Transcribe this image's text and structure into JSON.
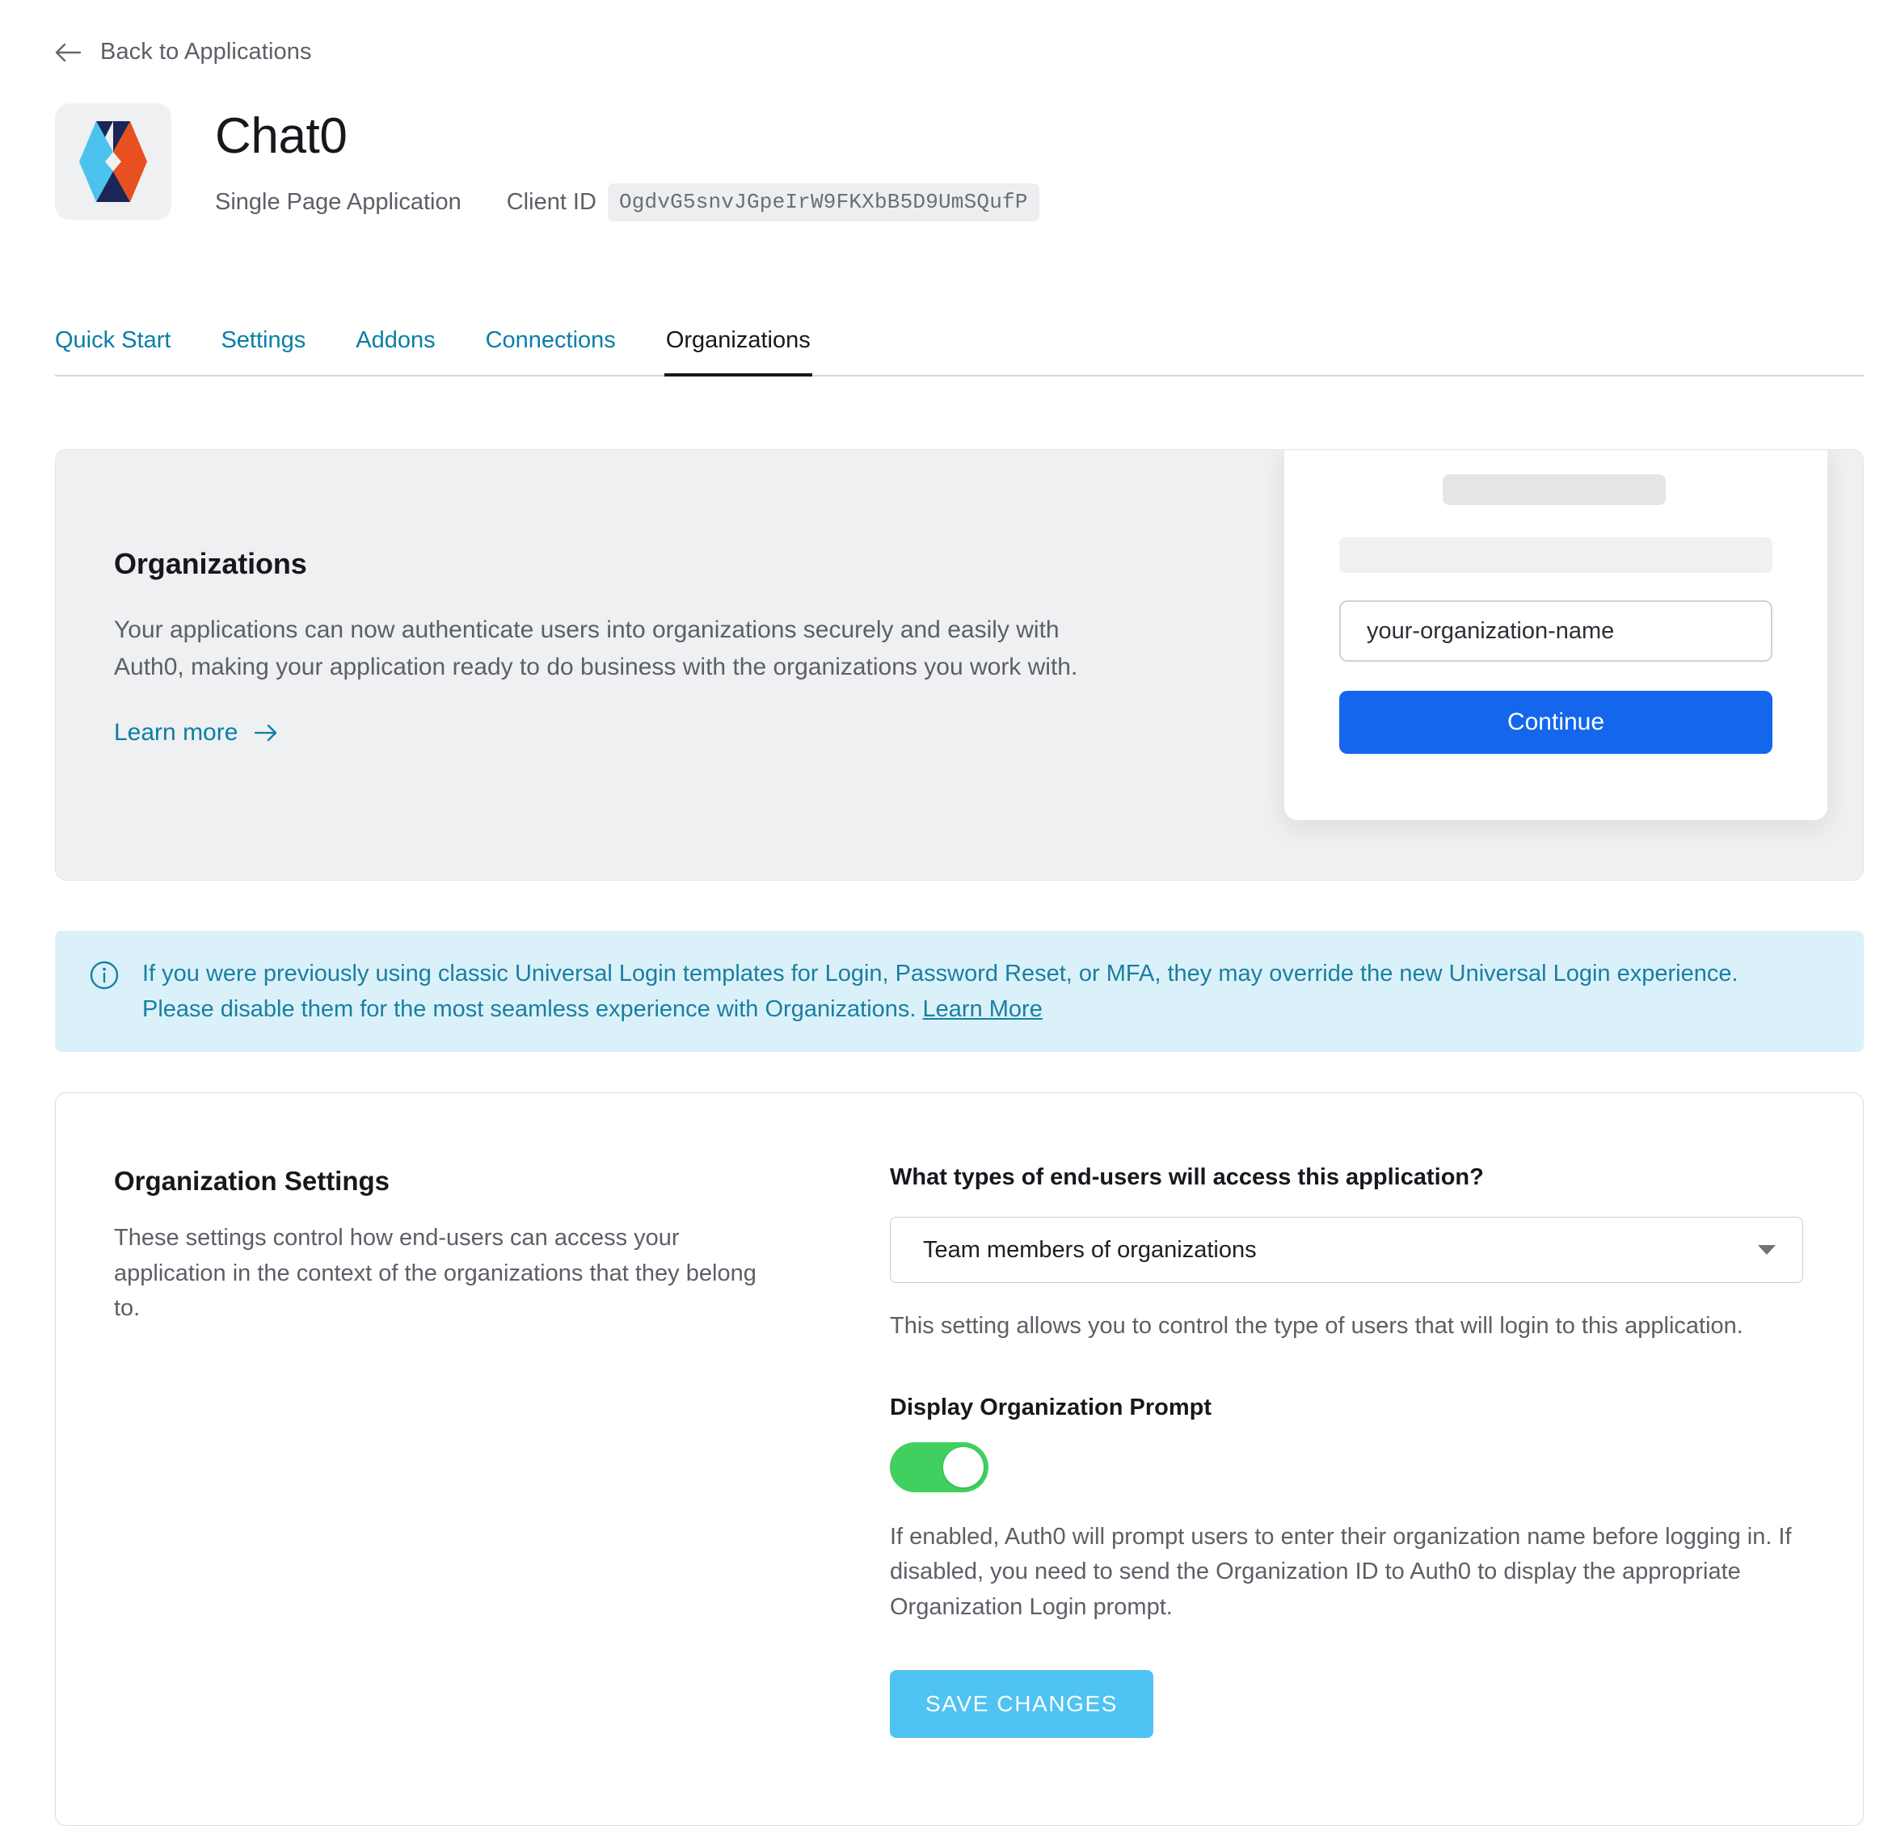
{
  "back": {
    "label": "Back to Applications",
    "icon": "arrow-left-icon"
  },
  "app": {
    "name": "Chat0",
    "type": "Single Page Application",
    "client_id_label": "Client ID",
    "client_id_value": "OgdvG5snvJGpeIrW9FKXbB5D9UmSQufP",
    "logo_icon": "auth0-app-logo-icon",
    "logo_colors": {
      "cyan": "#4cc3ee",
      "navy": "#1b2656",
      "orange": "#e8501f",
      "tile": "#eef0f1"
    }
  },
  "tabs": [
    {
      "label": "Quick Start",
      "active": false
    },
    {
      "label": "Settings",
      "active": false
    },
    {
      "label": "Addons",
      "active": false
    },
    {
      "label": "Connections",
      "active": false
    },
    {
      "label": "Organizations",
      "active": true
    }
  ],
  "hero": {
    "title": "Organizations",
    "body": "Your applications can now authenticate users into organizations securely and easily with Auth0, making your application ready to do business with the organizations you work with.",
    "link_label": "Learn more",
    "link_icon": "arrow-right-icon",
    "mock": {
      "input_value": "your-organization-name",
      "button_label": "Continue",
      "button_color": "#1467ed"
    }
  },
  "banner": {
    "icon": "info-circle-icon",
    "text": "If you were previously using classic Universal Login templates for Login, Password Reset, or MFA, they may override the new Universal Login experience. Please disable them for the most seamless experience with Organizations. ",
    "link_label": "Learn More",
    "background": "#daf1fa",
    "text_color": "#1a7fa0"
  },
  "settings": {
    "title": "Organization Settings",
    "description": "These settings control how end-users can access your application in the context of the organizations that they belong to.",
    "user_type": {
      "label": "What types of end-users will access this application?",
      "selected": "Team members of organizations",
      "help": "This setting allows you to control the type of users that will login to this application.",
      "caret_icon": "chevron-down-icon"
    },
    "display_prompt": {
      "label": "Display Organization Prompt",
      "enabled": true,
      "on_color": "#41d05f",
      "help": "If enabled, Auth0 will prompt users to enter their organization name before logging in. If disabled, you need to send the Organization ID to Auth0 to display the appropriate Organization Login prompt."
    },
    "save_label": "SAVE CHANGES",
    "save_color": "#4fc3f2"
  }
}
